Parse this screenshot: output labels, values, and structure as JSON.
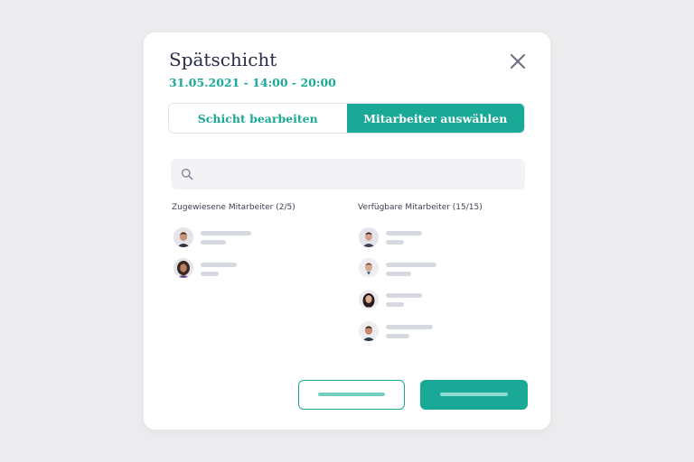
{
  "dialog": {
    "title": "Spätschicht",
    "subtitle": "31.05.2021 - 14:00 - 20:00"
  },
  "tabs": [
    {
      "label": "Schicht bearbeiten",
      "active": false
    },
    {
      "label": "Mitarbeiter auswählen",
      "active": true
    }
  ],
  "search": {
    "value": "",
    "placeholder": ""
  },
  "assigned": {
    "title": "Zugewiesene Mitarbeiter (2/5)"
  },
  "available": {
    "title": "Verfügbare Mitarbeiter (15/15)"
  },
  "colors": {
    "accent": "#1aa897",
    "title": "#2a2c4a",
    "placeholder_bar": "#d7d9e0",
    "background": "#ececef"
  }
}
